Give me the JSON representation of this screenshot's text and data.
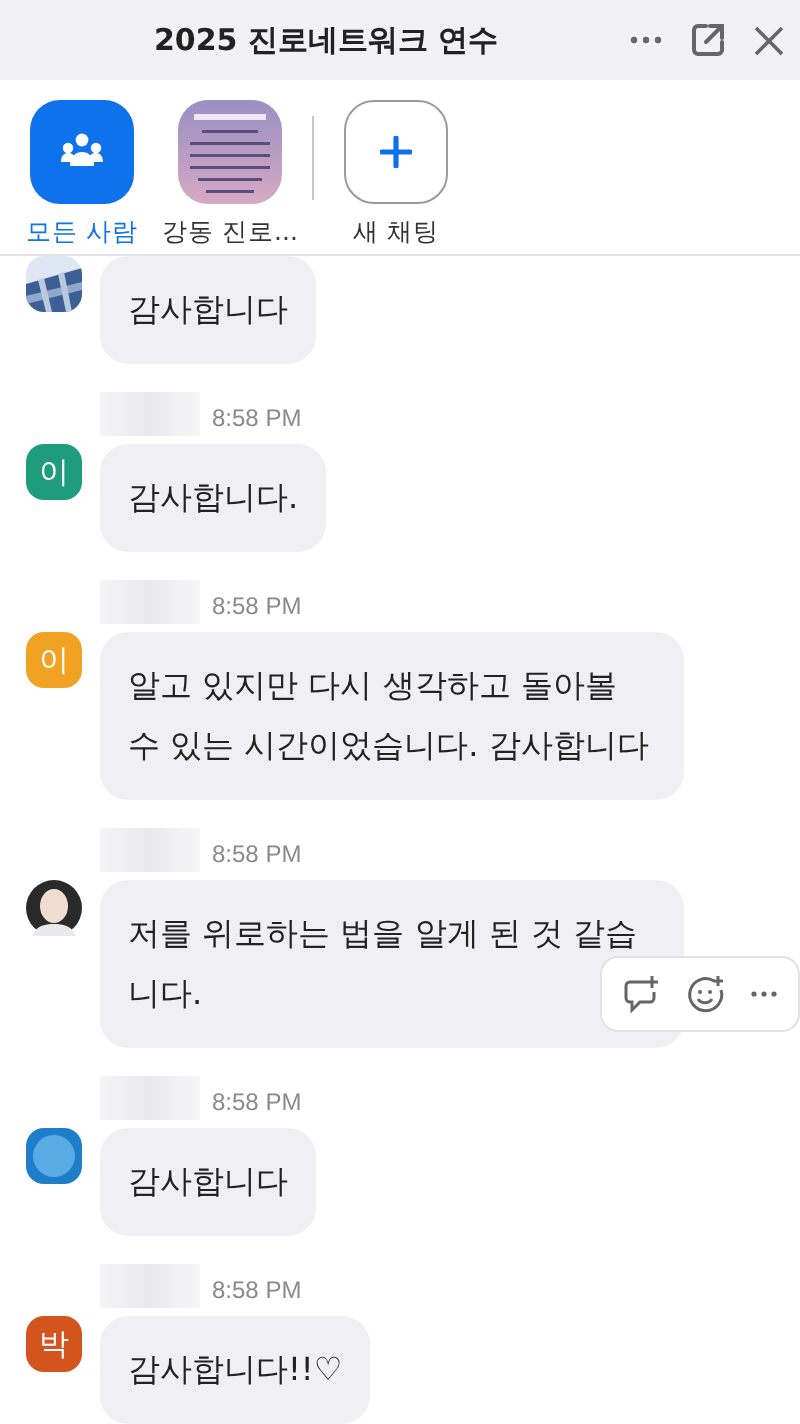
{
  "window": {
    "title": "2025 진로네트워크 연수"
  },
  "channels": [
    {
      "kind": "group",
      "label": "모든 사람",
      "selected": true
    },
    {
      "kind": "picture",
      "label": "강동 진로...",
      "selected": false
    },
    {
      "kind": "add",
      "label": "새 채팅",
      "selected": false
    }
  ],
  "messages": [
    {
      "text": "감사합니다",
      "hovered": false
    },
    {
      "time": "8:58 PM",
      "avatar": {
        "kind": "letter",
        "letter": "이",
        "color": "#1f9c7c"
      },
      "text": "감사합니다.",
      "hovered": false
    },
    {
      "time": "8:58 PM",
      "avatar": {
        "kind": "letter",
        "letter": "이",
        "color": "#f2a223"
      },
      "text": "알고 있지만 다시 생각하고 돌아볼 수 있는 시간이었습니다. 감사합니다",
      "hovered": false
    },
    {
      "time": "8:58 PM",
      "avatar": {
        "kind": "person"
      },
      "text": "저를 위로하는 법을 알게 된 것 같습니다.",
      "hovered": true
    },
    {
      "time": "8:58 PM",
      "avatar": {
        "kind": "circle"
      },
      "text": "감사합니다",
      "hovered": false
    },
    {
      "time": "8:58 PM",
      "avatar": {
        "kind": "letter",
        "letter": "박",
        "color": "#d4541e"
      },
      "text": "감사합니다!!♡",
      "hovered": false
    }
  ]
}
